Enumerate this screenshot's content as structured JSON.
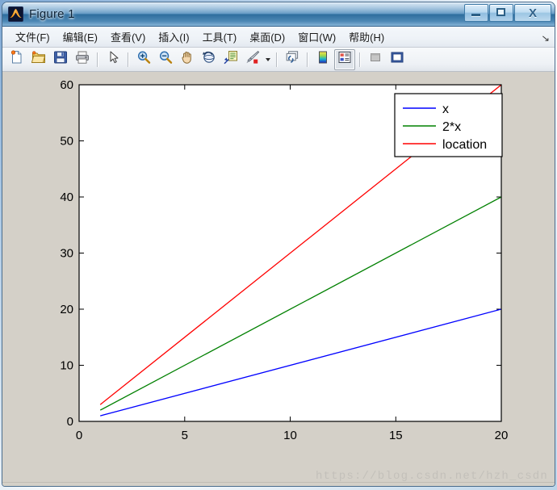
{
  "window": {
    "title": "Figure 1",
    "logo_icon": "matlab-membrane-icon",
    "controls": {
      "minimize_label": "–",
      "maximize_label": "□",
      "close_label": "X"
    }
  },
  "menu": {
    "items": [
      {
        "label": "文件(F)",
        "name": "menu-file"
      },
      {
        "label": "编辑(E)",
        "name": "menu-edit"
      },
      {
        "label": "查看(V)",
        "name": "menu-view"
      },
      {
        "label": "插入(I)",
        "name": "menu-insert"
      },
      {
        "label": "工具(T)",
        "name": "menu-tools"
      },
      {
        "label": "桌面(D)",
        "name": "menu-desktop"
      },
      {
        "label": "窗口(W)",
        "name": "menu-window"
      },
      {
        "label": "帮助(H)",
        "name": "menu-help"
      }
    ],
    "overflow_label": "↘"
  },
  "toolbar": {
    "buttons": [
      {
        "name": "new-figure-icon",
        "icon": "new-figure"
      },
      {
        "name": "open-file-icon",
        "icon": "open-folder"
      },
      {
        "name": "save-figure-icon",
        "icon": "floppy-save"
      },
      {
        "name": "print-figure-icon",
        "icon": "printer"
      },
      {
        "name": "separator-1",
        "icon": "separator"
      },
      {
        "name": "edit-plot-icon",
        "icon": "arrow-pointer"
      },
      {
        "name": "separator-2",
        "icon": "separator"
      },
      {
        "name": "zoom-in-icon",
        "icon": "magnifier-plus"
      },
      {
        "name": "zoom-out-icon",
        "icon": "magnifier-minus"
      },
      {
        "name": "pan-icon",
        "icon": "hand"
      },
      {
        "name": "rotate-3d-icon",
        "icon": "rotate-3d"
      },
      {
        "name": "data-cursor-icon",
        "icon": "data-cursor"
      },
      {
        "name": "insert-brush-icon",
        "icon": "brush"
      },
      {
        "name": "brush-dropdown-caret",
        "icon": "caret-down"
      },
      {
        "name": "separator-3",
        "icon": "separator"
      },
      {
        "name": "link-plot-icon",
        "icon": "link-plot"
      },
      {
        "name": "separator-4",
        "icon": "separator"
      },
      {
        "name": "figure-palette-icon",
        "icon": "color-palette"
      },
      {
        "name": "plot-browser-icon",
        "icon": "plot-browser"
      },
      {
        "name": "separator-5",
        "icon": "separator"
      },
      {
        "name": "property-editor-icon",
        "icon": "grey-square"
      },
      {
        "name": "hide-plot-tools-icon",
        "icon": "window-panel"
      }
    ]
  },
  "chart_data": {
    "type": "line",
    "title": "",
    "xlabel": "",
    "ylabel": "",
    "xlim": [
      0,
      20
    ],
    "ylim": [
      0,
      60
    ],
    "xticks": [
      0,
      5,
      10,
      15,
      20
    ],
    "yticks": [
      0,
      10,
      20,
      30,
      40,
      50,
      60
    ],
    "grid": false,
    "x": [
      1,
      20
    ],
    "series": [
      {
        "name": "x",
        "color": "#0000FF",
        "values": [
          1,
          20
        ]
      },
      {
        "name": "2*x",
        "color": "#008000",
        "values": [
          2,
          40
        ]
      },
      {
        "name": "location",
        "color": "#FF0000",
        "values": [
          3,
          60
        ]
      }
    ],
    "legend": {
      "position": "north-east",
      "entries": [
        {
          "label": "x",
          "color": "#0000FF"
        },
        {
          "label": "2*x",
          "color": "#008000"
        },
        {
          "label": "location",
          "color": "#FF0000"
        }
      ]
    },
    "axes_color": "#000000",
    "plot_background": "#FFFFFF",
    "figure_background": "#D4D0C8"
  },
  "watermark": {
    "text": "https://blog.csdn.net/hzh_csdn"
  }
}
